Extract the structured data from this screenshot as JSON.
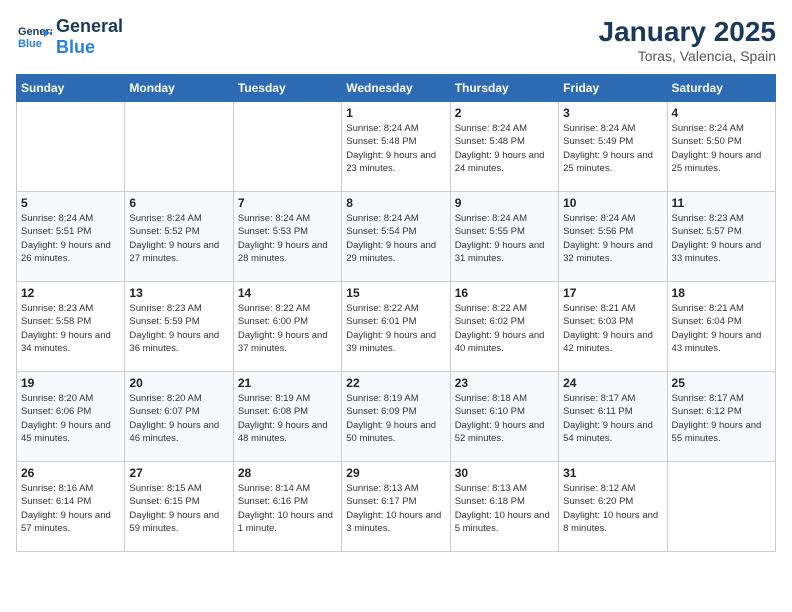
{
  "header": {
    "logo_general": "General",
    "logo_blue": "Blue",
    "title": "January 2025",
    "subtitle": "Toras, Valencia, Spain"
  },
  "weekdays": [
    "Sunday",
    "Monday",
    "Tuesday",
    "Wednesday",
    "Thursday",
    "Friday",
    "Saturday"
  ],
  "weeks": [
    [
      {
        "day": "",
        "info": ""
      },
      {
        "day": "",
        "info": ""
      },
      {
        "day": "",
        "info": ""
      },
      {
        "day": "1",
        "info": "Sunrise: 8:24 AM\nSunset: 5:48 PM\nDaylight: 9 hours and 23 minutes."
      },
      {
        "day": "2",
        "info": "Sunrise: 8:24 AM\nSunset: 5:48 PM\nDaylight: 9 hours and 24 minutes."
      },
      {
        "day": "3",
        "info": "Sunrise: 8:24 AM\nSunset: 5:49 PM\nDaylight: 9 hours and 25 minutes."
      },
      {
        "day": "4",
        "info": "Sunrise: 8:24 AM\nSunset: 5:50 PM\nDaylight: 9 hours and 25 minutes."
      }
    ],
    [
      {
        "day": "5",
        "info": "Sunrise: 8:24 AM\nSunset: 5:51 PM\nDaylight: 9 hours and 26 minutes."
      },
      {
        "day": "6",
        "info": "Sunrise: 8:24 AM\nSunset: 5:52 PM\nDaylight: 9 hours and 27 minutes."
      },
      {
        "day": "7",
        "info": "Sunrise: 8:24 AM\nSunset: 5:53 PM\nDaylight: 9 hours and 28 minutes."
      },
      {
        "day": "8",
        "info": "Sunrise: 8:24 AM\nSunset: 5:54 PM\nDaylight: 9 hours and 29 minutes."
      },
      {
        "day": "9",
        "info": "Sunrise: 8:24 AM\nSunset: 5:55 PM\nDaylight: 9 hours and 31 minutes."
      },
      {
        "day": "10",
        "info": "Sunrise: 8:24 AM\nSunset: 5:56 PM\nDaylight: 9 hours and 32 minutes."
      },
      {
        "day": "11",
        "info": "Sunrise: 8:23 AM\nSunset: 5:57 PM\nDaylight: 9 hours and 33 minutes."
      }
    ],
    [
      {
        "day": "12",
        "info": "Sunrise: 8:23 AM\nSunset: 5:58 PM\nDaylight: 9 hours and 34 minutes."
      },
      {
        "day": "13",
        "info": "Sunrise: 8:23 AM\nSunset: 5:59 PM\nDaylight: 9 hours and 36 minutes."
      },
      {
        "day": "14",
        "info": "Sunrise: 8:22 AM\nSunset: 6:00 PM\nDaylight: 9 hours and 37 minutes."
      },
      {
        "day": "15",
        "info": "Sunrise: 8:22 AM\nSunset: 6:01 PM\nDaylight: 9 hours and 39 minutes."
      },
      {
        "day": "16",
        "info": "Sunrise: 8:22 AM\nSunset: 6:02 PM\nDaylight: 9 hours and 40 minutes."
      },
      {
        "day": "17",
        "info": "Sunrise: 8:21 AM\nSunset: 6:03 PM\nDaylight: 9 hours and 42 minutes."
      },
      {
        "day": "18",
        "info": "Sunrise: 8:21 AM\nSunset: 6:04 PM\nDaylight: 9 hours and 43 minutes."
      }
    ],
    [
      {
        "day": "19",
        "info": "Sunrise: 8:20 AM\nSunset: 6:06 PM\nDaylight: 9 hours and 45 minutes."
      },
      {
        "day": "20",
        "info": "Sunrise: 8:20 AM\nSunset: 6:07 PM\nDaylight: 9 hours and 46 minutes."
      },
      {
        "day": "21",
        "info": "Sunrise: 8:19 AM\nSunset: 6:08 PM\nDaylight: 9 hours and 48 minutes."
      },
      {
        "day": "22",
        "info": "Sunrise: 8:19 AM\nSunset: 6:09 PM\nDaylight: 9 hours and 50 minutes."
      },
      {
        "day": "23",
        "info": "Sunrise: 8:18 AM\nSunset: 6:10 PM\nDaylight: 9 hours and 52 minutes."
      },
      {
        "day": "24",
        "info": "Sunrise: 8:17 AM\nSunset: 6:11 PM\nDaylight: 9 hours and 54 minutes."
      },
      {
        "day": "25",
        "info": "Sunrise: 8:17 AM\nSunset: 6:12 PM\nDaylight: 9 hours and 55 minutes."
      }
    ],
    [
      {
        "day": "26",
        "info": "Sunrise: 8:16 AM\nSunset: 6:14 PM\nDaylight: 9 hours and 57 minutes."
      },
      {
        "day": "27",
        "info": "Sunrise: 8:15 AM\nSunset: 6:15 PM\nDaylight: 9 hours and 59 minutes."
      },
      {
        "day": "28",
        "info": "Sunrise: 8:14 AM\nSunset: 6:16 PM\nDaylight: 10 hours and 1 minute."
      },
      {
        "day": "29",
        "info": "Sunrise: 8:13 AM\nSunset: 6:17 PM\nDaylight: 10 hours and 3 minutes."
      },
      {
        "day": "30",
        "info": "Sunrise: 8:13 AM\nSunset: 6:18 PM\nDaylight: 10 hours and 5 minutes."
      },
      {
        "day": "31",
        "info": "Sunrise: 8:12 AM\nSunset: 6:20 PM\nDaylight: 10 hours and 8 minutes."
      },
      {
        "day": "",
        "info": ""
      }
    ]
  ]
}
